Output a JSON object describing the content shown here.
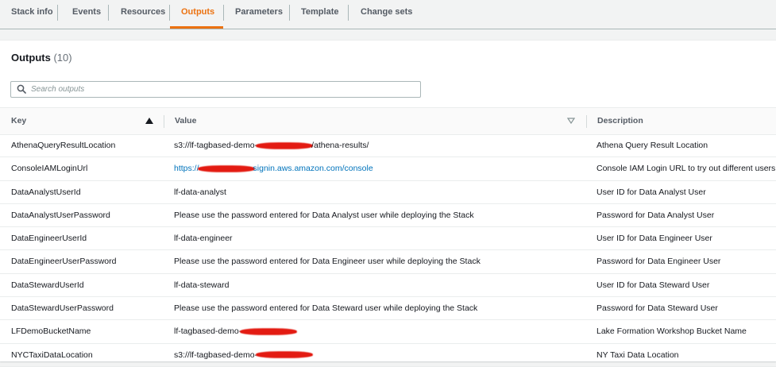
{
  "tabs": [
    {
      "label": "Stack info",
      "active": false
    },
    {
      "label": "Events",
      "active": false
    },
    {
      "label": "Resources",
      "active": false
    },
    {
      "label": "Outputs",
      "active": true
    },
    {
      "label": "Parameters",
      "active": false
    },
    {
      "label": "Template",
      "active": false
    },
    {
      "label": "Change sets",
      "active": false
    }
  ],
  "panel": {
    "title": "Outputs",
    "count": "(10)"
  },
  "search": {
    "placeholder": "Search outputs",
    "value": ""
  },
  "table": {
    "columns": [
      "Key",
      "Value",
      "Description"
    ],
    "sort": {
      "column": "Key",
      "direction": "ascending"
    },
    "rows": [
      {
        "key": "AthenaQueryResultLocation",
        "value_prefix": "s3://lf-tagbased-demo-",
        "value_suffix": "/athena-results/",
        "redacted": true,
        "link": false,
        "description": "Athena Query Result Location"
      },
      {
        "key": "ConsoleIAMLoginUrl",
        "value_prefix": "https://",
        "value_suffix": "signin.aws.amazon.com/console",
        "redacted": true,
        "link": true,
        "description": "Console IAM Login URL to try out different users"
      },
      {
        "key": "DataAnalystUserId",
        "value_prefix": "lf-data-analyst",
        "value_suffix": "",
        "redacted": false,
        "link": false,
        "description": "User ID for Data Analyst User"
      },
      {
        "key": "DataAnalystUserPassword",
        "value_prefix": "Please use the password entered for Data Analyst user while deploying the Stack",
        "value_suffix": "",
        "redacted": false,
        "link": false,
        "description": "Password for Data Analyst User"
      },
      {
        "key": "DataEngineerUserId",
        "value_prefix": "lf-data-engineer",
        "value_suffix": "",
        "redacted": false,
        "link": false,
        "description": "User ID for Data Engineer User"
      },
      {
        "key": "DataEngineerUserPassword",
        "value_prefix": "Please use the password entered for Data Engineer user while deploying the Stack",
        "value_suffix": "",
        "redacted": false,
        "link": false,
        "description": "Password for Data Engineer User"
      },
      {
        "key": "DataStewardUserId",
        "value_prefix": "lf-data-steward",
        "value_suffix": "",
        "redacted": false,
        "link": false,
        "description": "User ID for Data Steward User"
      },
      {
        "key": "DataStewardUserPassword",
        "value_prefix": "Please use the password entered for Data Steward user while deploying the Stack",
        "value_suffix": "",
        "redacted": false,
        "link": false,
        "description": "Password for Data Steward User"
      },
      {
        "key": "LFDemoBucketName",
        "value_prefix": "lf-tagbased-demo-",
        "value_suffix": "",
        "redacted": true,
        "link": false,
        "description": "Lake Formation Workshop Bucket Name"
      },
      {
        "key": "NYCTaxiDataLocation",
        "value_prefix": "s3://lf-tagbased-demo-",
        "value_suffix": "",
        "redacted": true,
        "link": false,
        "description": "NY Taxi Data Location"
      }
    ]
  },
  "colors": {
    "accent": "#ec7211",
    "link": "#0073bb",
    "redaction": "#e31b12"
  }
}
